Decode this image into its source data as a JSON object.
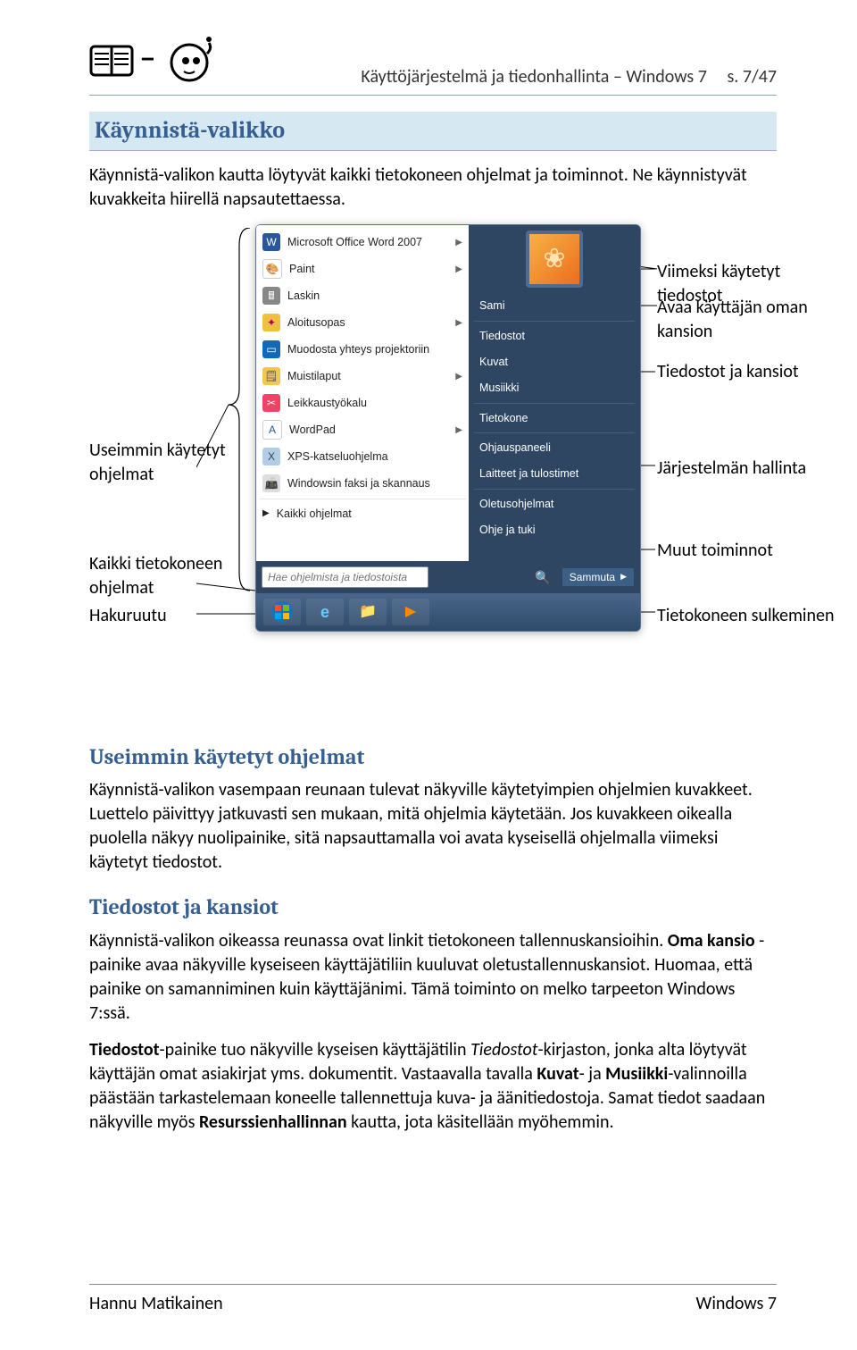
{
  "header": {
    "title": "Käyttöjärjestelmä ja tiedonhallinta – Windows 7",
    "page_indicator": "s. 7/47"
  },
  "headings": {
    "h2_startmenu": "Käynnistä-valikko",
    "h3_freq": "Useimmin käytetyt ohjelmat",
    "h3_files": "Tiedostot ja kansiot"
  },
  "intro_para": "Käynnistä-valikon kautta löytyvät kaikki tietokoneen ohjelmat ja toiminnot. Ne käynnistyvät kuvakkeita hiirellä napsautettaessa.",
  "annotations": {
    "left_freq": "Useimmin käytetyt ohjelmat",
    "left_allprogs": "Kaikki tietokoneen ohjelmat",
    "left_search": "Hakuruutu",
    "right_recent": "Viimeksi käytetyt tiedostot",
    "right_userfolder": "Avaa käyttäjän oman kansion",
    "right_filesfolders": "Tiedostot ja kansiot",
    "right_syscontrol": "Järjestelmän hallinta",
    "right_other": "Muut toiminnot",
    "right_shutdown": "Tietokoneen sulkeminen"
  },
  "startmenu": {
    "left_items": [
      "Microsoft Office Word 2007",
      "Paint",
      "Laskin",
      "Aloitusopas",
      "Muodosta yhteys projektoriin",
      "Muistilaput",
      "Leikkaustyökalu",
      "WordPad",
      "XPS-katseluohjelma",
      "Windowsin faksi ja skannaus"
    ],
    "all_programs": "Kaikki ohjelmat",
    "search_placeholder": "Hae ohjelmista ja tiedostoista",
    "shutdown_label": "Sammuta",
    "right_items": [
      "Sami",
      "Tiedostot",
      "Kuvat",
      "Musiikki",
      "Tietokone",
      "Ohjauspaneeli",
      "Laitteet ja tulostimet",
      "Oletusohjelmat",
      "Ohje ja tuki"
    ]
  },
  "body": {
    "freq_para": "Käynnistä-valikon vasempaan reunaan tulevat näkyville käytetyimpien ohjelmien kuvakkeet. Luettelo päivittyy jatkuvasti sen mukaan, mitä ohjelmia käytetään. Jos kuvakkeen oikealla puolella näkyy nuolipainike, sitä napsauttamalla voi avata kyseisellä ohjelmalla viimeksi käytetyt tiedostot.",
    "files_para1_a": "Käynnistä-valikon oikeassa reunassa ovat linkit tietokoneen tallennuskansioihin. ",
    "files_para1_b": "Oma kansio",
    "files_para1_c": " -painike avaa näkyville kyseiseen käyttäjätiliin kuuluvat oletustallennuskansiot. Huomaa, että painike on samanniminen kuin käyttäjänimi. Tämä toiminto on melko tarpeeton Windows 7:ssä.",
    "files_para2_a": "Tiedostot",
    "files_para2_b": "-painike tuo näkyville kyseisen käyttäjätilin ",
    "files_para2_c": "Tiedostot",
    "files_para2_d": "-kirjaston, jonka alta löytyvät käyttäjän omat asiakirjat yms. dokumentit. Vastaavalla tavalla ",
    "files_para2_e": "Kuvat",
    "files_para2_f": "- ja ",
    "files_para2_g": "Musiikki",
    "files_para2_h": "-valinnoilla päästään tarkastelemaan koneelle tallennettuja kuva- ja äänitiedostoja. Samat tiedot saadaan näkyville myös ",
    "files_para2_i": "Resurssienhallinnan",
    "files_para2_j": " kautta, jota käsitellään myöhemmin."
  },
  "footer": {
    "left": "Hannu Matikainen",
    "right": "Windows 7"
  }
}
